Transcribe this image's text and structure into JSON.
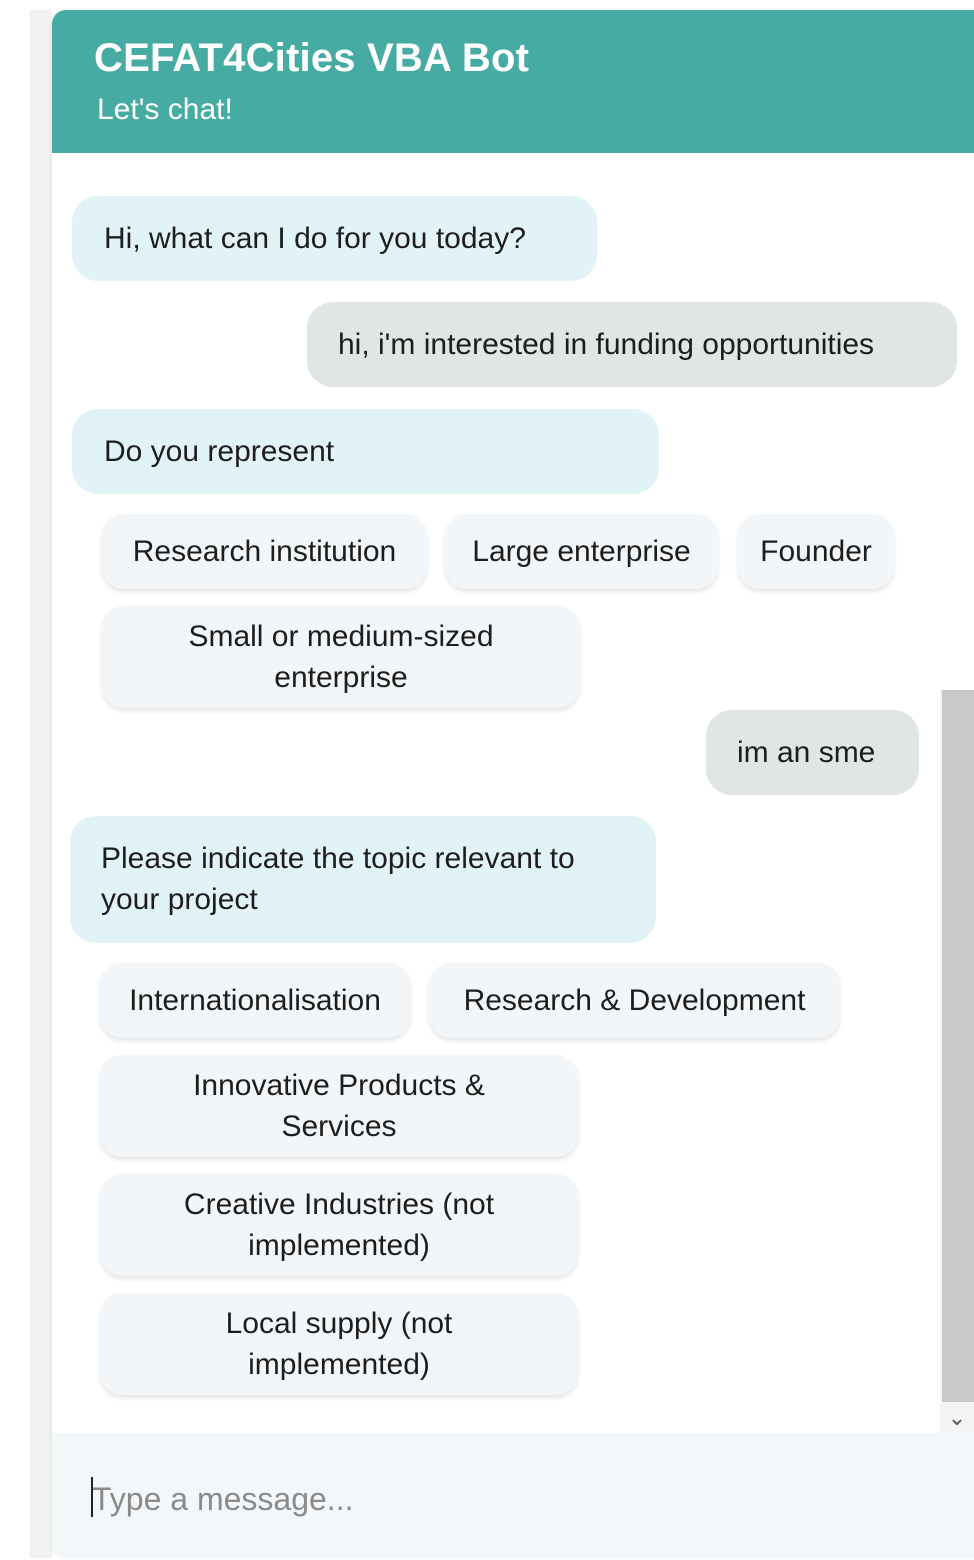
{
  "header": {
    "title": "CEFAT4Cities VBA Bot",
    "subtitle": "Let's chat!"
  },
  "messages": [
    {
      "from": "bot",
      "text": "Hi, what can I do for you today?"
    },
    {
      "from": "user",
      "text": "hi, i'm interested in funding opportunities"
    },
    {
      "from": "bot",
      "text": "Do you represent"
    },
    {
      "from": "user",
      "text": "im an sme"
    },
    {
      "from": "bot",
      "text": "Please indicate the topic relevant to your project"
    }
  ],
  "options_group_1": [
    "Research institution",
    "Large enterprise",
    "Founder",
    "Small or medium-sized enterprise"
  ],
  "options_group_2": [
    "Internationalisation",
    "Research & Development",
    "Innovative Products & Services",
    "Creative Industries (not implemented)",
    "Local supply (not implemented)"
  ],
  "composer": {
    "placeholder": "Type a message..."
  },
  "icons": {
    "scroll_down": "chevron-down-icon"
  },
  "colors": {
    "header": "#46aba3",
    "bot_bubble": "#e2f3f8",
    "user_bubble": "#e0e6e1",
    "chip": "#f2f6f9"
  }
}
